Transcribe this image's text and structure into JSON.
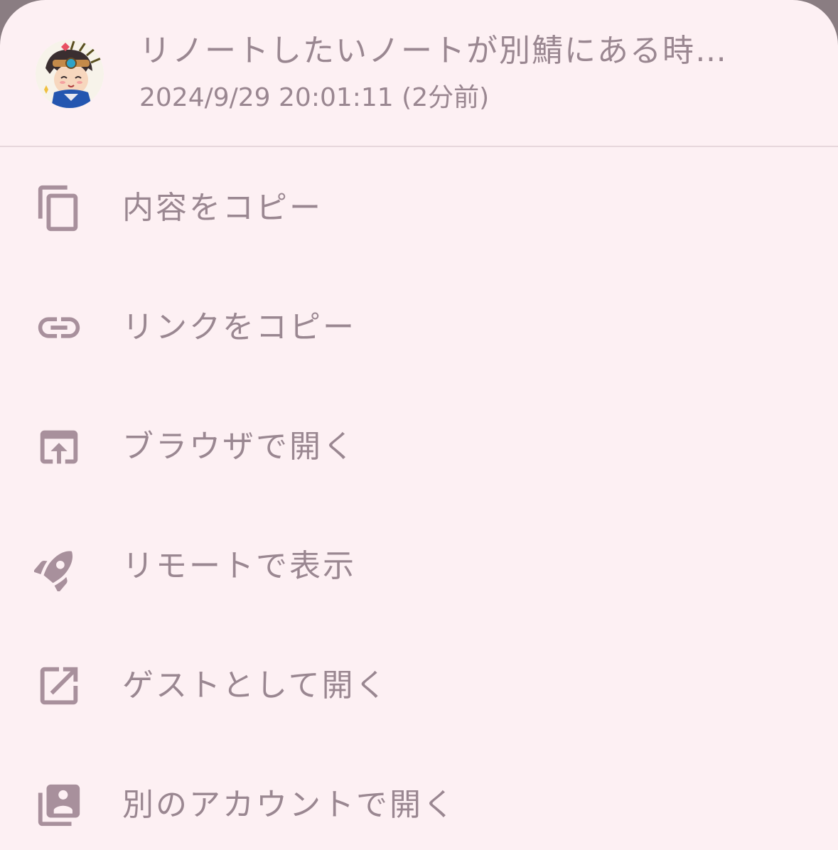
{
  "note": {
    "title": "リノートしたいノートが別鯖にある時…",
    "time": "2024/9/29 20:01:11 (2分前)"
  },
  "menu": {
    "items": [
      {
        "label": "内容をコピー",
        "icon": "copy-icon"
      },
      {
        "label": "リンクをコピー",
        "icon": "link-icon"
      },
      {
        "label": "ブラウザで開く",
        "icon": "open-in-browser-icon"
      },
      {
        "label": "リモートで表示",
        "icon": "rocket-icon"
      },
      {
        "label": "ゲストとして開く",
        "icon": "open-in-new-icon"
      },
      {
        "label": "別のアカウントで開く",
        "icon": "account-box-icon"
      }
    ]
  },
  "colors": {
    "sheet_background": "#fdf0f3",
    "text": "#9a8791",
    "icon": "#a8909c",
    "divider": "#e6d6db"
  }
}
